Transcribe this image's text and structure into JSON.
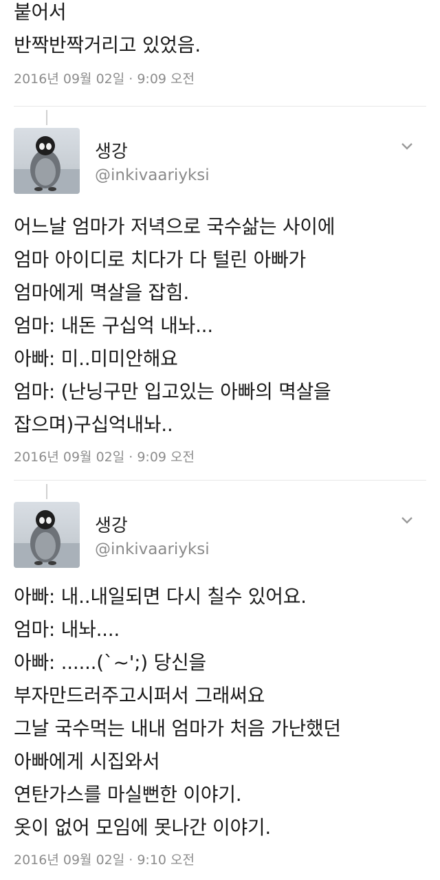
{
  "top": {
    "lines": [
      "붙어서",
      "반짝반짝거리고 있었음."
    ],
    "timestamp": "2016년 09월 02일 · 9:09 오전"
  },
  "tweets": [
    {
      "name": "생강",
      "handle": "@inkivaariyksi",
      "lines": [
        "어느날 엄마가 저녁으로 국수삶는 사이에",
        "엄마 아이디로 치다가 다 털린 아빠가",
        "엄마에게 멱살을 잡힘.",
        "엄마: 내돈 구십억 내놔...",
        "아빠: 미..미미안해요",
        "엄마: (난닝구만 입고있는 아빠의 멱살을",
        "잡으며)구십억내놔.."
      ],
      "timestamp": "2016년 09월 02일 · 9:09 오전"
    },
    {
      "name": "생강",
      "handle": "@inkivaariyksi",
      "lines": [
        "아빠: 내..내일되면 다시 칠수 있어요.",
        "엄마: 내놔....",
        "아빠: ......(`~';) 당신을",
        "부자만드러주고시퍼서 그래써요",
        "그날 국수먹는 내내 엄마가 처음 가난했던",
        "아빠에게 시집와서",
        "연탄가스를 마실뻔한 이야기.",
        "옷이 없어 모임에 못나간 이야기."
      ],
      "timestamp": "2016년 09월 02일 · 9:10 오전"
    }
  ]
}
